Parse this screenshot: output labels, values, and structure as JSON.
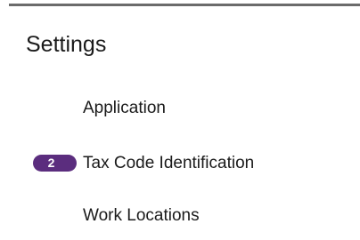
{
  "settings": {
    "title": "Settings",
    "items": [
      {
        "label": "Application"
      },
      {
        "label": "Tax Code Identification",
        "badge": "2"
      },
      {
        "label": "Work Locations"
      }
    ]
  },
  "colors": {
    "badge_background": "#5b2d7e",
    "badge_text": "#ffffff",
    "rule": "#6b6b6b",
    "text": "#1a1a1a"
  }
}
